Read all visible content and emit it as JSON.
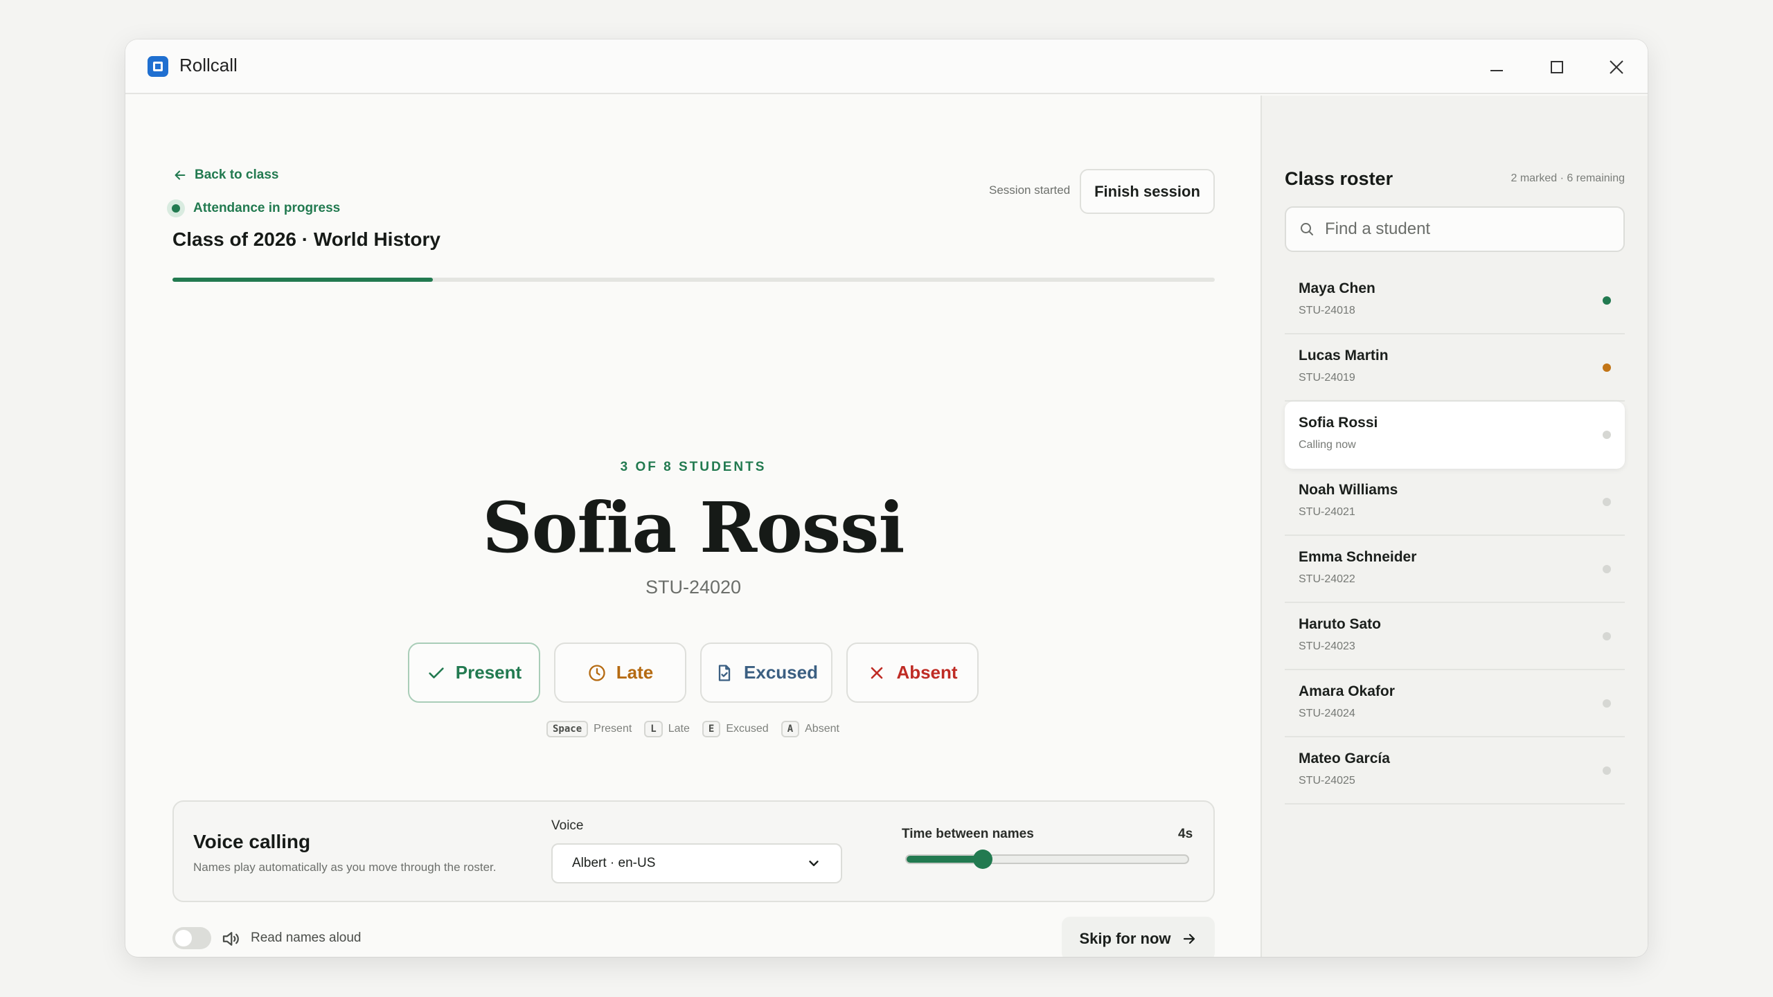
{
  "app": {
    "title": "Rollcall"
  },
  "header": {
    "back_label": "Back to class",
    "status": "Attendance in progress",
    "class_title": "Class of 2026 · World History",
    "session_label": "Session started",
    "finish_label": "Finish session",
    "progress_fraction": 0.25
  },
  "current": {
    "counter": "3 OF 8 STUDENTS",
    "name": "Sofia Rossi",
    "id": "STU-24020"
  },
  "actions": {
    "present": "Present",
    "late": "Late",
    "excused": "Excused",
    "absent": "Absent"
  },
  "shortcuts": [
    {
      "key": "Space",
      "label": "Present"
    },
    {
      "key": "L",
      "label": "Late"
    },
    {
      "key": "E",
      "label": "Excused"
    },
    {
      "key": "A",
      "label": "Absent"
    }
  ],
  "voice": {
    "title": "Voice calling",
    "subtitle": "Names play automatically as you move through the roster.",
    "voice_label": "Voice",
    "voice_value": "Albert · en-US",
    "gap_label": "Time between names",
    "gap_value": "4s",
    "gap_fraction": 0.27
  },
  "footer": {
    "read_aloud": "Read names aloud",
    "skip_label": "Skip for now"
  },
  "roster": {
    "title": "Class roster",
    "count": "2 marked · 6 remaining",
    "search_placeholder": "Find a student",
    "items": [
      {
        "name": "Maya Chen",
        "sub": "STU-24018",
        "status_color": "#227a50"
      },
      {
        "name": "Lucas Martin",
        "sub": "STU-24019",
        "status_color": "#c27516"
      },
      {
        "name": "Sofia Rossi",
        "sub": "Calling now",
        "status_color": "#d6d7d3"
      },
      {
        "name": "Noah Williams",
        "sub": "STU-24021",
        "status_color": "#d6d7d3"
      },
      {
        "name": "Emma Schneider",
        "sub": "STU-24022",
        "status_color": "#d6d7d3"
      },
      {
        "name": "Haruto Sato",
        "sub": "STU-24023",
        "status_color": "#d6d7d3"
      },
      {
        "name": "Amara Okafor",
        "sub": "STU-24024",
        "status_color": "#d6d7d3"
      },
      {
        "name": "Mateo García",
        "sub": "STU-24025",
        "status_color": "#d6d7d3"
      }
    ]
  },
  "colors": {
    "accent": "#227a50",
    "late": "#b56a11",
    "excused": "#3b5f82",
    "absent": "#bf2c25",
    "brand": "#1f6fd0"
  }
}
